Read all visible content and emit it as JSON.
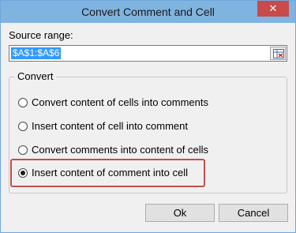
{
  "window": {
    "title": "Convert Comment and Cell",
    "close_glyph": "✕"
  },
  "source": {
    "label": "Source range:",
    "value": "$A$1:$A$6",
    "range_button_icon": "range-select-icon"
  },
  "convert": {
    "label": "Convert",
    "options": [
      {
        "label": "Convert content of cells into comments",
        "selected": false
      },
      {
        "label": "Insert content of cell into comment",
        "selected": false
      },
      {
        "label": "Convert comments into content of cells",
        "selected": false
      },
      {
        "label": "Insert content of comment into cell",
        "selected": true
      }
    ]
  },
  "buttons": {
    "ok": "Ok",
    "cancel": "Cancel"
  },
  "colors": {
    "titlebar": "#7fb3e0",
    "close": "#c94a4a",
    "selection": "#3399ff",
    "highlight": "#c0504d"
  }
}
